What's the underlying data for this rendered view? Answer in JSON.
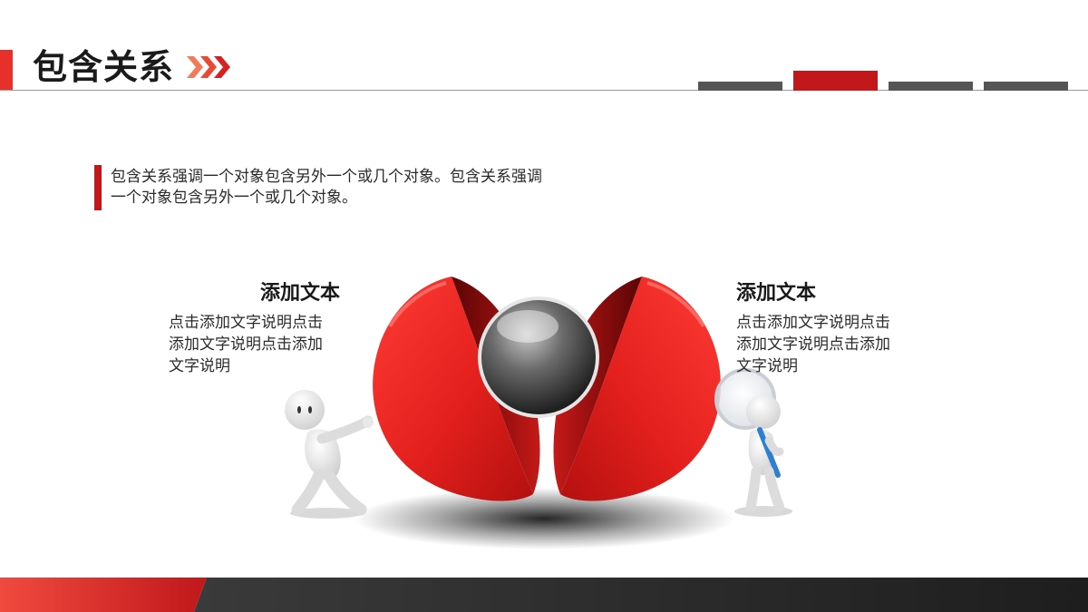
{
  "header": {
    "title": "包含关系",
    "tabs": [
      {
        "active": false
      },
      {
        "active": true
      },
      {
        "active": false
      },
      {
        "active": false
      }
    ]
  },
  "intro": {
    "line1": "包含关系强调一个对象包含另外一个或几个对象。包含关系强调",
    "line2": "一个对象包含另外一个或几个对象。"
  },
  "left_block": {
    "title": "添加文本",
    "line1": "点击添加文字说明点击",
    "line2": "添加文字说明点击添加",
    "line3": "文字说明"
  },
  "right_block": {
    "title": "添加文本",
    "line1": "点击添加文字说明点击",
    "line2": "添加文字说明点击添加",
    "line3": "文字说明"
  },
  "colors": {
    "accent_red": "#c0181b",
    "bright_red": "#e8302b",
    "dark_gray": "#555555",
    "footer_dark": "#2b2b2b"
  },
  "icons": {
    "title_arrows": "triple-chevron-right-icon",
    "sphere": "split-red-sphere-with-gray-ball",
    "left_figure": "pushing-stick-figure",
    "right_figure": "magnifying-glass-stick-figure"
  }
}
